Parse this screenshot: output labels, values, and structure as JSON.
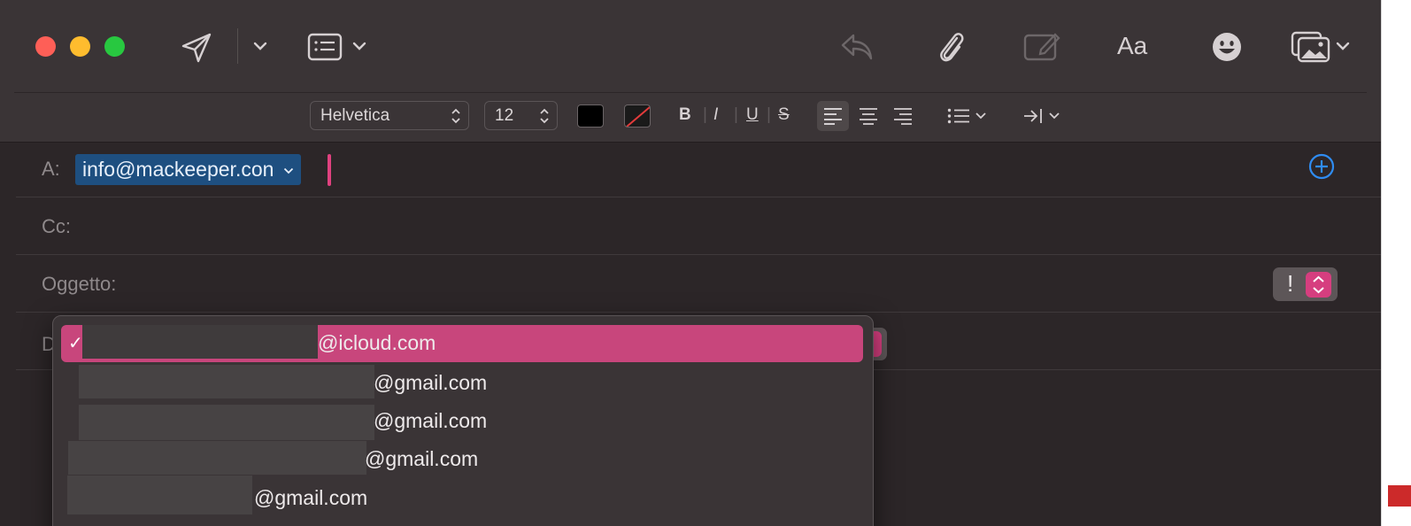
{
  "toolbar": {
    "font_name": "Helvetica",
    "font_size": "12",
    "format": {
      "bold": "B",
      "italic": "I",
      "underline": "U",
      "strike": "S"
    },
    "fonts_button": "Aa",
    "icons": [
      "send-icon",
      "chevron-down-icon",
      "header-fields-icon",
      "reply-icon",
      "paperclip-icon",
      "markup-icon",
      "fonts-icon",
      "emoji-icon",
      "photo-browser-icon",
      "list-icon",
      "indent-icon"
    ]
  },
  "fields": {
    "to_label": "A:",
    "to_token": "info@mackeeper.con",
    "cc_label": "Cc:",
    "subject_label": "Oggetto:",
    "from_label": "D",
    "priority_label": "!"
  },
  "from_menu": {
    "items": [
      {
        "domain": "@icloud.com",
        "selected": true
      },
      {
        "domain": "@gmail.com",
        "selected": false
      },
      {
        "domain": "@gmail.com",
        "selected": false
      },
      {
        "domain": "@gmail.com",
        "selected": false
      },
      {
        "domain": "@gmail.com",
        "selected": false
      }
    ],
    "check": "✓"
  },
  "colors": {
    "accent": "#c8467c",
    "token_bg": "#1e4f80",
    "window_bg": "#2c2628"
  }
}
